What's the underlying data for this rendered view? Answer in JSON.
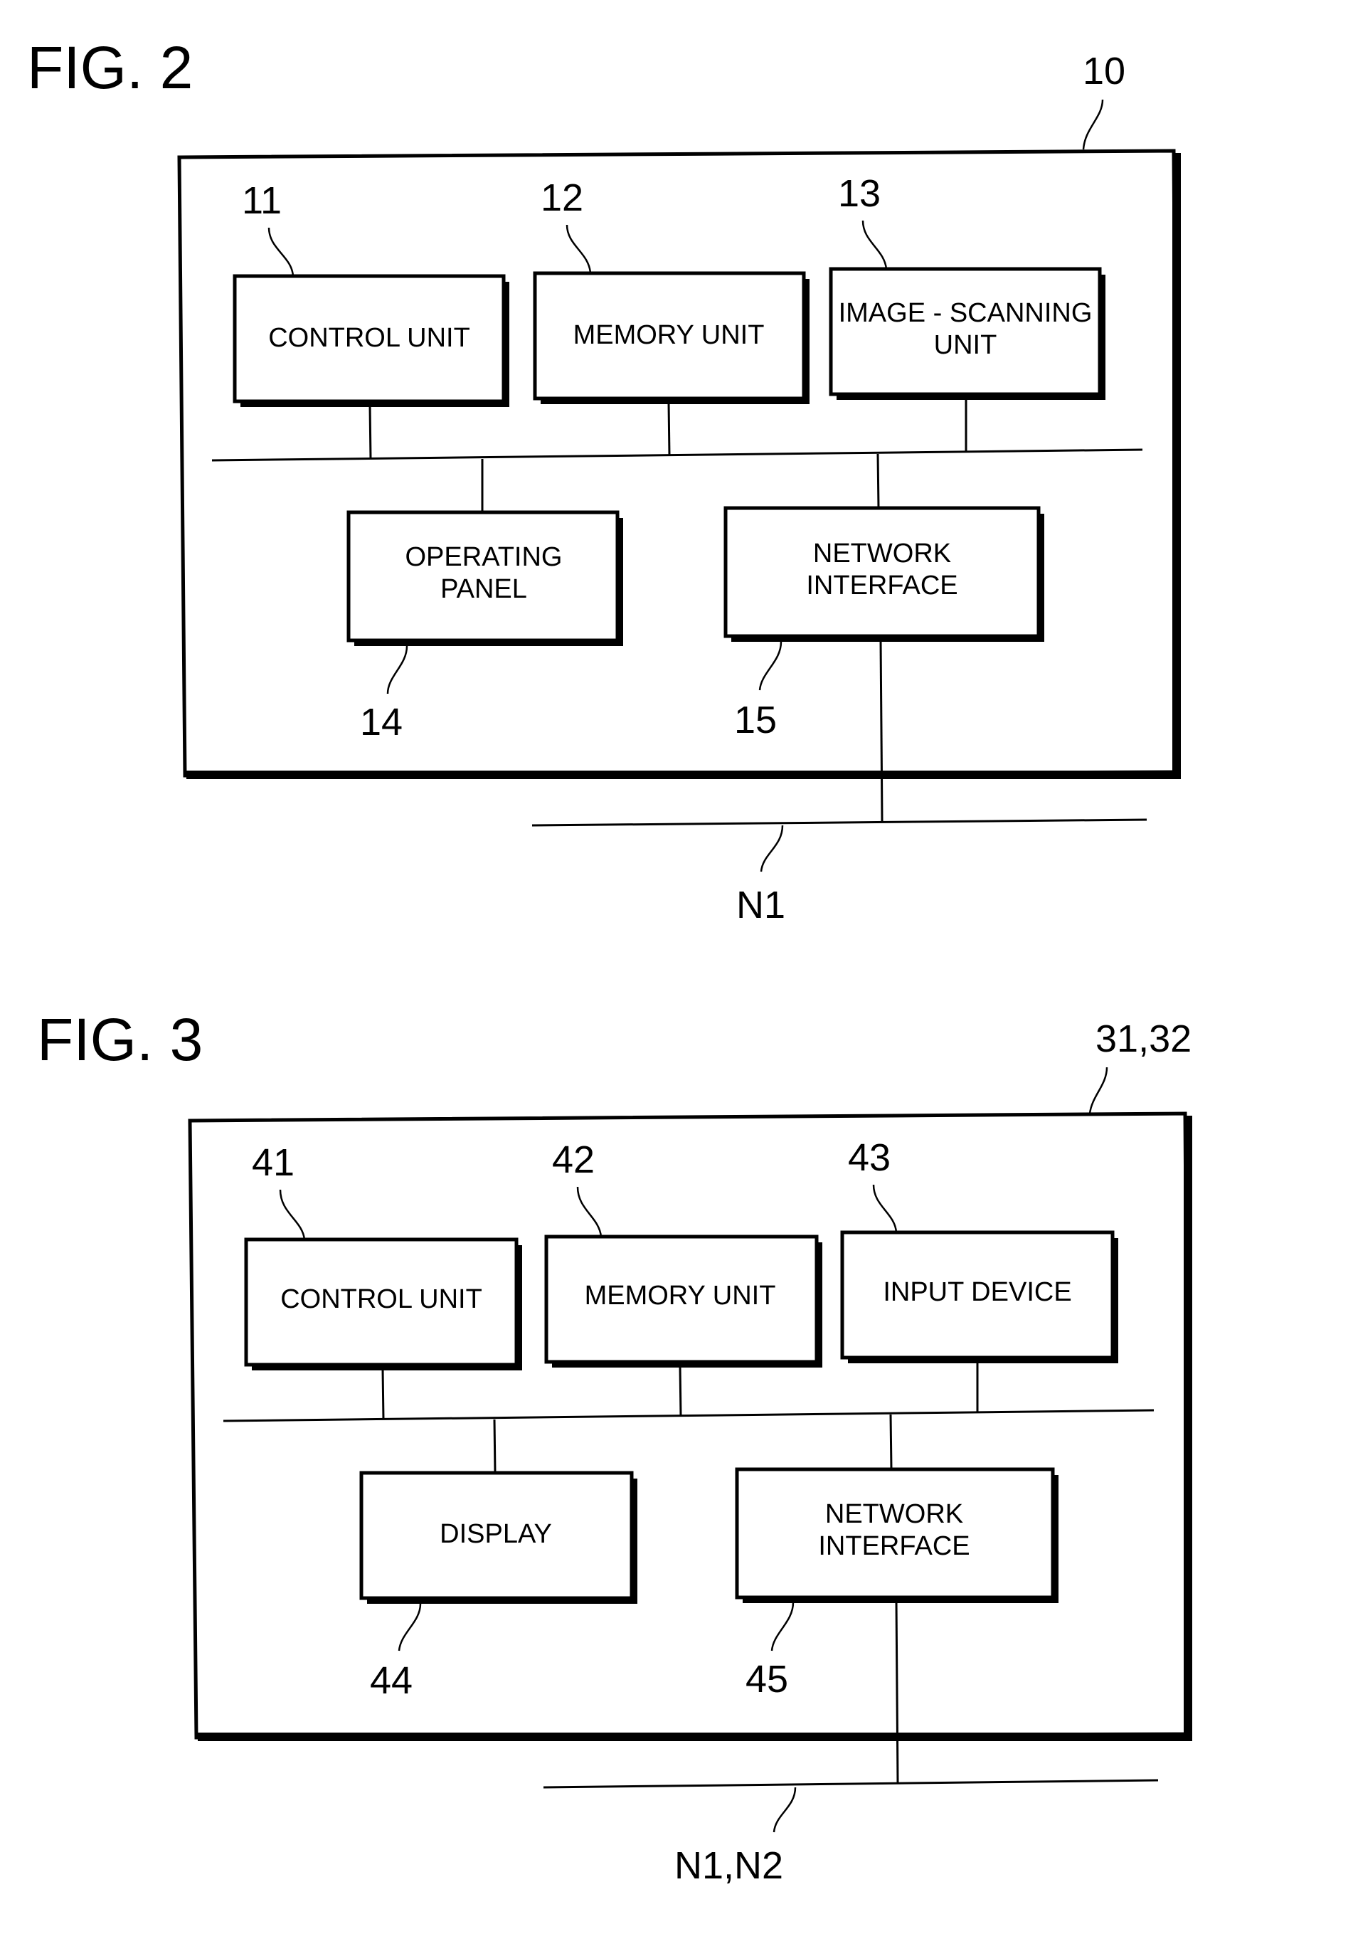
{
  "fig2": {
    "title": "FIG. 2",
    "device_ref": "10",
    "network_ref": "N1",
    "blocks": [
      {
        "ref": "11",
        "lines": [
          "CONTROL UNIT"
        ]
      },
      {
        "ref": "12",
        "lines": [
          "MEMORY UNIT"
        ]
      },
      {
        "ref": "13",
        "lines": [
          "IMAGE - SCANNING",
          "UNIT"
        ]
      },
      {
        "ref": "14",
        "lines": [
          "OPERATING",
          "PANEL"
        ]
      },
      {
        "ref": "15",
        "lines": [
          "NETWORK",
          "INTERFACE"
        ]
      }
    ]
  },
  "fig3": {
    "title": "FIG. 3",
    "device_ref": "31,32",
    "network_ref": "N1,N2",
    "blocks": [
      {
        "ref": "41",
        "lines": [
          "CONTROL UNIT"
        ]
      },
      {
        "ref": "42",
        "lines": [
          "MEMORY UNIT"
        ]
      },
      {
        "ref": "43",
        "lines": [
          "INPUT DEVICE"
        ]
      },
      {
        "ref": "44",
        "lines": [
          "DISPLAY"
        ]
      },
      {
        "ref": "45",
        "lines": [
          "NETWORK",
          "INTERFACE"
        ]
      }
    ]
  }
}
